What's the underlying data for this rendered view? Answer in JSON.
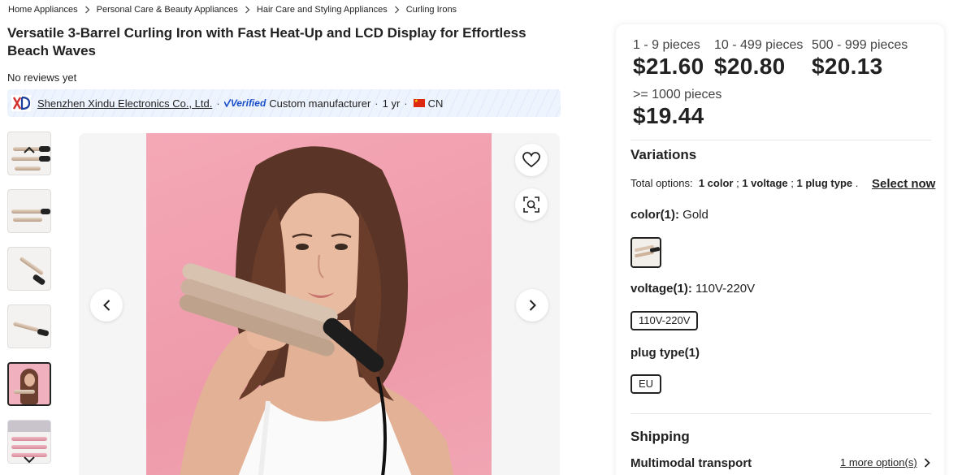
{
  "breadcrumb": [
    {
      "label": "Home Appliances"
    },
    {
      "label": "Personal Care & Beauty Appliances"
    },
    {
      "label": "Hair Care and Styling Appliances"
    },
    {
      "label": "Curling Irons"
    }
  ],
  "product": {
    "title": "Versatile 3-Barrel Curling Iron with Fast Heat-Up and LCD Display for Effortless Beach Waves",
    "reviews": "No reviews yet"
  },
  "supplier": {
    "name": "Shenzhen Xindu Electronics Co., Ltd.",
    "verified_label": "Verified",
    "type": "Custom manufacturer",
    "years": "1 yr",
    "country": "CN"
  },
  "pricing": [
    {
      "range": "1 - 9 pieces",
      "price": "$21.60"
    },
    {
      "range": "10 - 499 pieces",
      "price": "$20.80"
    },
    {
      "range": "500 - 999 pieces",
      "price": "$20.13"
    },
    {
      "range": ">= 1000 pieces",
      "price": "$19.44"
    }
  ],
  "variations": {
    "title": "Variations",
    "total_label": "Total options:",
    "total_color": "1 color",
    "total_voltage": "1 voltage",
    "total_plug": "1 plug type",
    "select_now": "Select now",
    "color_label": "color(1):",
    "color_value": "Gold",
    "voltage_label": "voltage(1):",
    "voltage_value": "110V-220V",
    "voltage_option": "110V-220V",
    "plug_label": "plug type(1)",
    "plug_option": "EU"
  },
  "shipping": {
    "title": "Shipping",
    "method": "Multimodal transport",
    "more_options": "1 more option(s)"
  },
  "colors": {
    "verified_blue": "#1a4ec9",
    "photo_background": "#f4a8b6",
    "supplier_bar": "#eef4fd"
  }
}
